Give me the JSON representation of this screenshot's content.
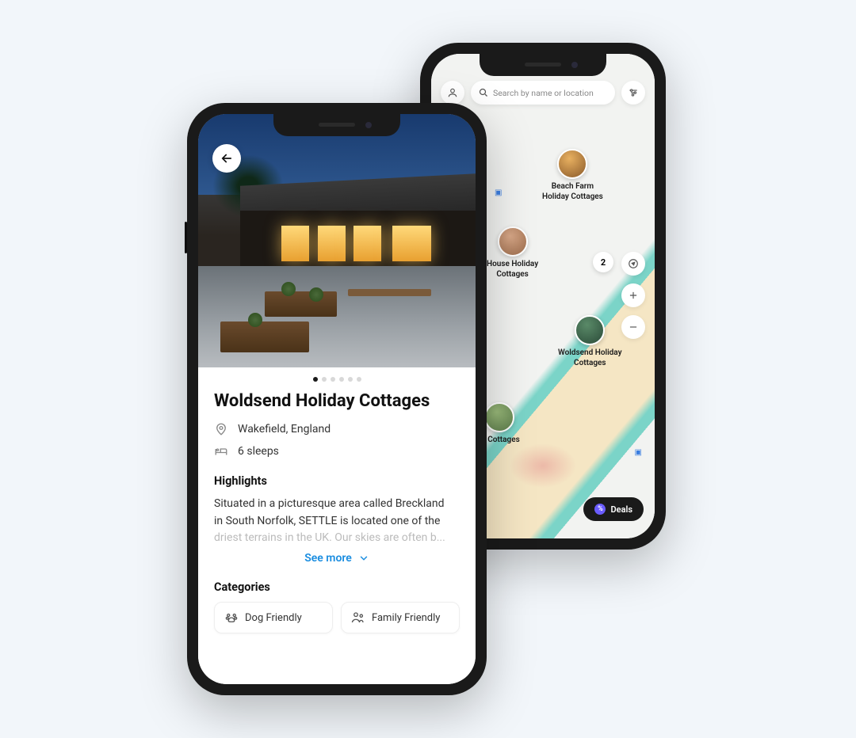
{
  "detail": {
    "title": "Woldsend Holiday Cottages",
    "location": "Wakefield, England",
    "sleeps": "6 sleeps",
    "pager_total": 6,
    "pager_active": 0,
    "highlights_heading": "Highlights",
    "description_line1": "Situated in a picturesque area called Breckland",
    "description_line2": "in South Norfolk, SETTLE is located one of the",
    "description_line3": "driest terrains in the UK. Our skies are often b...",
    "see_more_label": "See more",
    "categories_heading": "Categories",
    "categories": [
      {
        "icon": "paw",
        "label": "Dog Friendly"
      },
      {
        "icon": "family",
        "label": "Family Friendly"
      }
    ]
  },
  "map": {
    "search_placeholder": "Search by name or location",
    "cluster_count": "2",
    "deals_label": "Deals",
    "pins": [
      {
        "name_line1": "Beach Farm",
        "name_line2": "Holiday Cottages",
        "color": "#c78a3a"
      },
      {
        "name_line1": "House Holiday",
        "name_line2": "Cottages",
        "color": "#b88a6a"
      },
      {
        "name_line1": "Woldsend Holiday",
        "name_line2": "Cottages",
        "color": "#3a5a48"
      },
      {
        "name_line1": "te Cottages",
        "name_line2": "",
        "color": "#7a9a5a"
      }
    ]
  }
}
